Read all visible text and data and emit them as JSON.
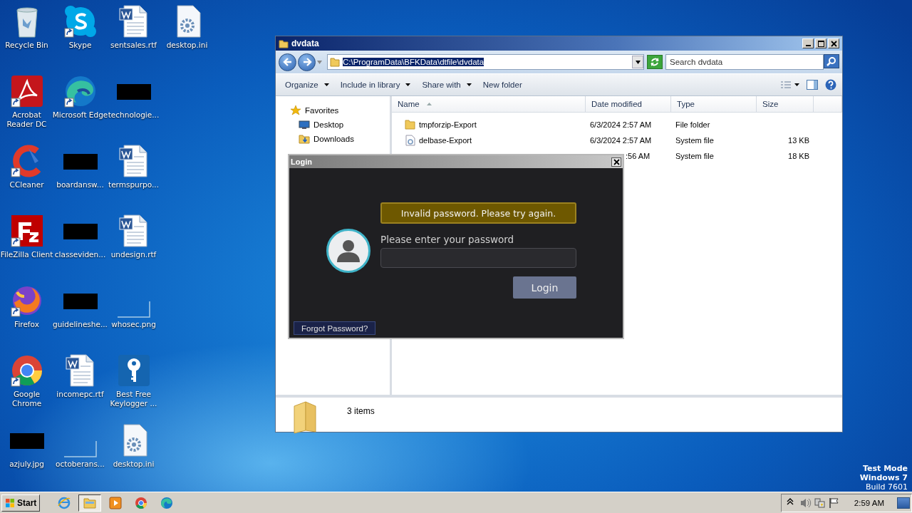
{
  "desktop": {
    "icons": [
      {
        "label": "Recycle Bin",
        "kind": "recycle",
        "shortcut": false
      },
      {
        "label": "Acrobat Reader DC",
        "kind": "acrobat",
        "shortcut": true
      },
      {
        "label": "CCleaner",
        "kind": "ccleaner",
        "shortcut": true
      },
      {
        "label": "FileZilla Client",
        "kind": "filezilla",
        "shortcut": true
      },
      {
        "label": "Firefox",
        "kind": "firefox",
        "shortcut": true
      },
      {
        "label": "Google Chrome",
        "kind": "chrome",
        "shortcut": true
      },
      {
        "label": "azjuly.jpg",
        "kind": "redacted",
        "shortcut": false
      },
      {
        "label": "Skype",
        "kind": "skype",
        "shortcut": true
      },
      {
        "label": "Microsoft Edge",
        "kind": "edge",
        "shortcut": true
      },
      {
        "label": "boardansw...",
        "kind": "redacted",
        "shortcut": false
      },
      {
        "label": "classeviden...",
        "kind": "redacted",
        "shortcut": false
      },
      {
        "label": "guidelineshe...",
        "kind": "redacted",
        "shortcut": false
      },
      {
        "label": "incomepc.rtf",
        "kind": "word",
        "shortcut": false
      },
      {
        "label": "octoberans...",
        "kind": "blank",
        "shortcut": false
      },
      {
        "label": "sentsales.rtf",
        "kind": "word",
        "shortcut": false
      },
      {
        "label": "technologie...",
        "kind": "redacted",
        "shortcut": false
      },
      {
        "label": "termspurpo...",
        "kind": "word",
        "shortcut": false
      },
      {
        "label": "undesign.rtf",
        "kind": "word",
        "shortcut": false
      },
      {
        "label": "whosec.png",
        "kind": "blank",
        "shortcut": false
      },
      {
        "label": "Best Free Keylogger ...",
        "kind": "keylogger",
        "shortcut": false
      },
      {
        "label": "desktop.ini",
        "kind": "ini",
        "shortcut": false
      },
      {
        "label": "desktop.ini",
        "kind": "ini",
        "shortcut": false
      }
    ]
  },
  "explorer": {
    "title": "dvdata",
    "address": "C:\\ProgramData\\BFKData\\dtfile\\dvdata",
    "address_selected": true,
    "search_placeholder": "Search dvdata",
    "toolbar": [
      {
        "label": "Organize",
        "dropdown": true
      },
      {
        "label": "Include in library",
        "dropdown": true
      },
      {
        "label": "Share with",
        "dropdown": true
      },
      {
        "label": "New folder",
        "dropdown": false
      }
    ],
    "nav": [
      {
        "label": "Favorites",
        "kind": "star"
      },
      {
        "label": "Desktop",
        "kind": "desktop"
      },
      {
        "label": "Downloads",
        "kind": "downloads"
      }
    ],
    "columns": [
      "Name",
      "Date modified",
      "Type",
      "Size"
    ],
    "rows": [
      {
        "name": "tmpforzip-Export",
        "kind": "folder",
        "date": "6/3/2024 2:57 AM",
        "type": "File folder",
        "size": ""
      },
      {
        "name": "delbase-Export",
        "kind": "sysfile",
        "date": "6/3/2024 2:57 AM",
        "type": "System file",
        "size": "13 KB"
      },
      {
        "name": "",
        "kind": "hidden",
        "date": ":56 AM",
        "type": "System file",
        "size": "18 KB"
      }
    ],
    "status": "3 items"
  },
  "login": {
    "title": "Login",
    "error": "Invalid password. Please try again.",
    "prompt": "Please enter your password",
    "button": "Login",
    "forgot": "Forgot Password?"
  },
  "taskbar": {
    "start": "Start",
    "apps": [
      {
        "kind": "ie",
        "selected": false
      },
      {
        "kind": "explorer",
        "selected": true
      },
      {
        "kind": "media",
        "selected": false
      },
      {
        "kind": "chrome",
        "selected": false
      },
      {
        "kind": "edge",
        "selected": false
      }
    ],
    "time": "2:59 AM"
  },
  "os_info": [
    "Test Mode",
    "Windows 7",
    "Build 7601"
  ]
}
